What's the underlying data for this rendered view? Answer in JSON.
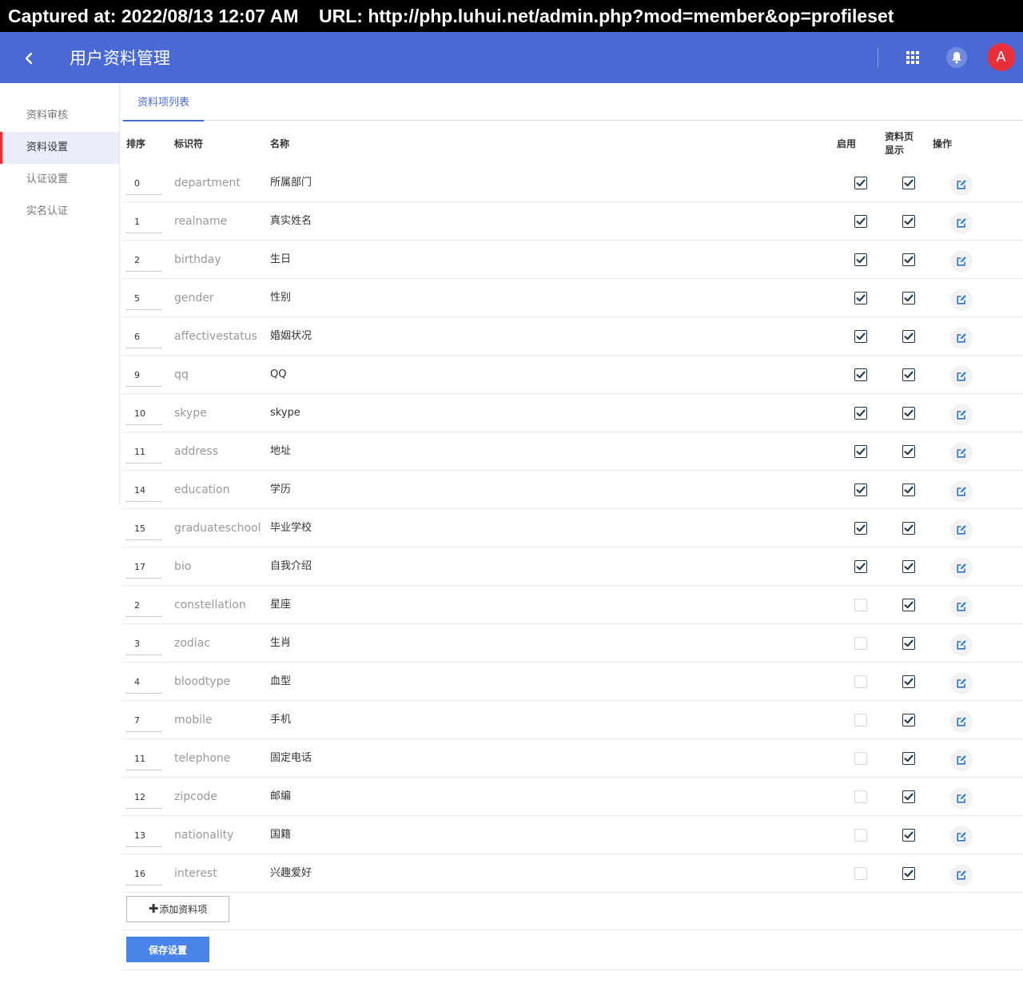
{
  "capture_banner": "Captured at: 2022/08/13 12:07 AM    URL: http://php.luhui.net/admin.php?mod=member&op=profileset",
  "header": {
    "title": "用户资料管理",
    "avatar_letter": "A",
    "brand_color": "#4a69d4",
    "avatar_color": "#e8303d"
  },
  "sidebar": {
    "items": [
      {
        "label": "资料审核",
        "active": false
      },
      {
        "label": "资料设置",
        "active": true
      },
      {
        "label": "认证设置",
        "active": false
      },
      {
        "label": "实名认证",
        "active": false
      }
    ]
  },
  "tabs": [
    {
      "label": "资料项列表",
      "active": true
    }
  ],
  "table": {
    "headers": {
      "order": "排序",
      "identifier": "标识符",
      "name": "名称",
      "enable": "启用",
      "show_line1": "资料页",
      "show_line2": "显示",
      "actions": "操作"
    },
    "rows": [
      {
        "order": "0",
        "identifier": "department",
        "name": "所属部门",
        "enabled": true,
        "shown": true
      },
      {
        "order": "1",
        "identifier": "realname",
        "name": "真实姓名",
        "enabled": true,
        "shown": true
      },
      {
        "order": "2",
        "identifier": "birthday",
        "name": "生日",
        "enabled": true,
        "shown": true
      },
      {
        "order": "5",
        "identifier": "gender",
        "name": "性别",
        "enabled": true,
        "shown": true
      },
      {
        "order": "6",
        "identifier": "affectivestatus",
        "name": "婚姻状况",
        "enabled": true,
        "shown": true
      },
      {
        "order": "9",
        "identifier": "qq",
        "name": "QQ",
        "enabled": true,
        "shown": true
      },
      {
        "order": "10",
        "identifier": "skype",
        "name": "skype",
        "enabled": true,
        "shown": true
      },
      {
        "order": "11",
        "identifier": "address",
        "name": "地址",
        "enabled": true,
        "shown": true
      },
      {
        "order": "14",
        "identifier": "education",
        "name": "学历",
        "enabled": true,
        "shown": true
      },
      {
        "order": "15",
        "identifier": "graduateschool",
        "name": "毕业学校",
        "enabled": true,
        "shown": true
      },
      {
        "order": "17",
        "identifier": "bio",
        "name": "自我介绍",
        "enabled": true,
        "shown": true
      },
      {
        "order": "2",
        "identifier": "constellation",
        "name": "星座",
        "enabled": false,
        "shown": true
      },
      {
        "order": "3",
        "identifier": "zodiac",
        "name": "生肖",
        "enabled": false,
        "shown": true
      },
      {
        "order": "4",
        "identifier": "bloodtype",
        "name": "血型",
        "enabled": false,
        "shown": true
      },
      {
        "order": "7",
        "identifier": "mobile",
        "name": "手机",
        "enabled": false,
        "shown": true
      },
      {
        "order": "11",
        "identifier": "telephone",
        "name": "固定电话",
        "enabled": false,
        "shown": true
      },
      {
        "order": "12",
        "identifier": "zipcode",
        "name": "邮编",
        "enabled": false,
        "shown": true
      },
      {
        "order": "13",
        "identifier": "nationality",
        "name": "国籍",
        "enabled": false,
        "shown": true
      },
      {
        "order": "16",
        "identifier": "interest",
        "name": "兴趣爱好",
        "enabled": false,
        "shown": true
      }
    ]
  },
  "buttons": {
    "add_label": "添加资料项",
    "save_label": "保存设置"
  },
  "icons": {
    "back": "chevron-left-icon",
    "apps": "apps-grid-icon",
    "notifications": "bell-icon",
    "add": "plus-icon",
    "edit": "edit-icon",
    "check": "checkmark-icon"
  }
}
